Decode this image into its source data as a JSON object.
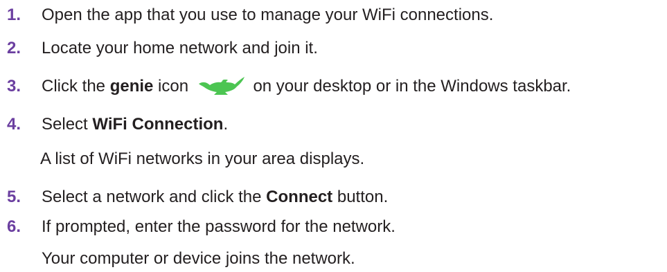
{
  "steps": [
    {
      "number": "1.",
      "text": "Open the app that you use to manage your WiFi connections."
    },
    {
      "number": "2.",
      "text": "Locate your home network and join it."
    },
    {
      "number": "3.",
      "pre": "Click the ",
      "bold": "genie",
      "mid": " icon",
      "post": " on your desktop or in the Windows taskbar.",
      "icon": "genie-lamp-icon",
      "icon_color": "#4cc552"
    },
    {
      "number": "4.",
      "pre": "Select ",
      "bold": "WiFi Connection",
      "post": ".",
      "note": "A list of WiFi networks in your area displays."
    },
    {
      "number": "5.",
      "pre": "Select a network and click the ",
      "bold": "Connect",
      "post": " button."
    },
    {
      "number": "6.",
      "text": "If prompted, enter the password for the network.",
      "note": "Your computer or device joins the network."
    }
  ],
  "colors": {
    "step_number": "#6b3fa0",
    "body_text": "#231f20",
    "genie_icon": "#4cc552"
  }
}
